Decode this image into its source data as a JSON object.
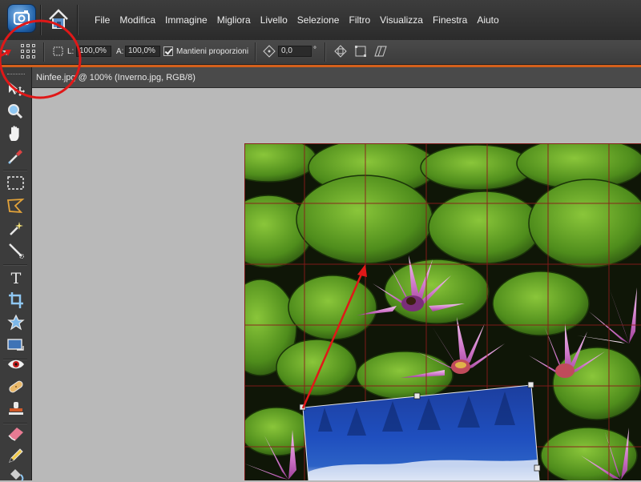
{
  "menubar": {
    "items": [
      "File",
      "Modifica",
      "Immagine",
      "Migliora",
      "Livello",
      "Selezione",
      "Filtro",
      "Visualizza",
      "Finestra",
      "Aiuto"
    ]
  },
  "options": {
    "width_label": "L:",
    "width_value": "100,0%",
    "height_label": "A:",
    "height_value": "100,0%",
    "constrain_label": "Mantieni proporzioni",
    "constrain_checked": true,
    "angle_value": "0,0",
    "angle_unit": "°"
  },
  "document": {
    "tab_title": "Ninfee.jpg @ 100% (Inverno.jpg, RGB/8)"
  },
  "colors": {
    "accent": "#d4601b",
    "annotation": "#e01818",
    "grid": "#8b1a1a",
    "transform_handle": "#a6ff7a"
  },
  "tools": [
    "move-tool",
    "zoom-tool",
    "hand-tool",
    "eyedropper-tool",
    "marquee-tool",
    "lasso-tool",
    "magic-wand-tool",
    "quick-selection-tool",
    "type-tool",
    "crop-tool",
    "cookie-cutter-tool",
    "recompose-tool",
    "red-eye-tool",
    "healing-brush-tool",
    "clone-stamp-tool",
    "eraser-tool",
    "pencil-tool",
    "paint-bucket-tool"
  ]
}
